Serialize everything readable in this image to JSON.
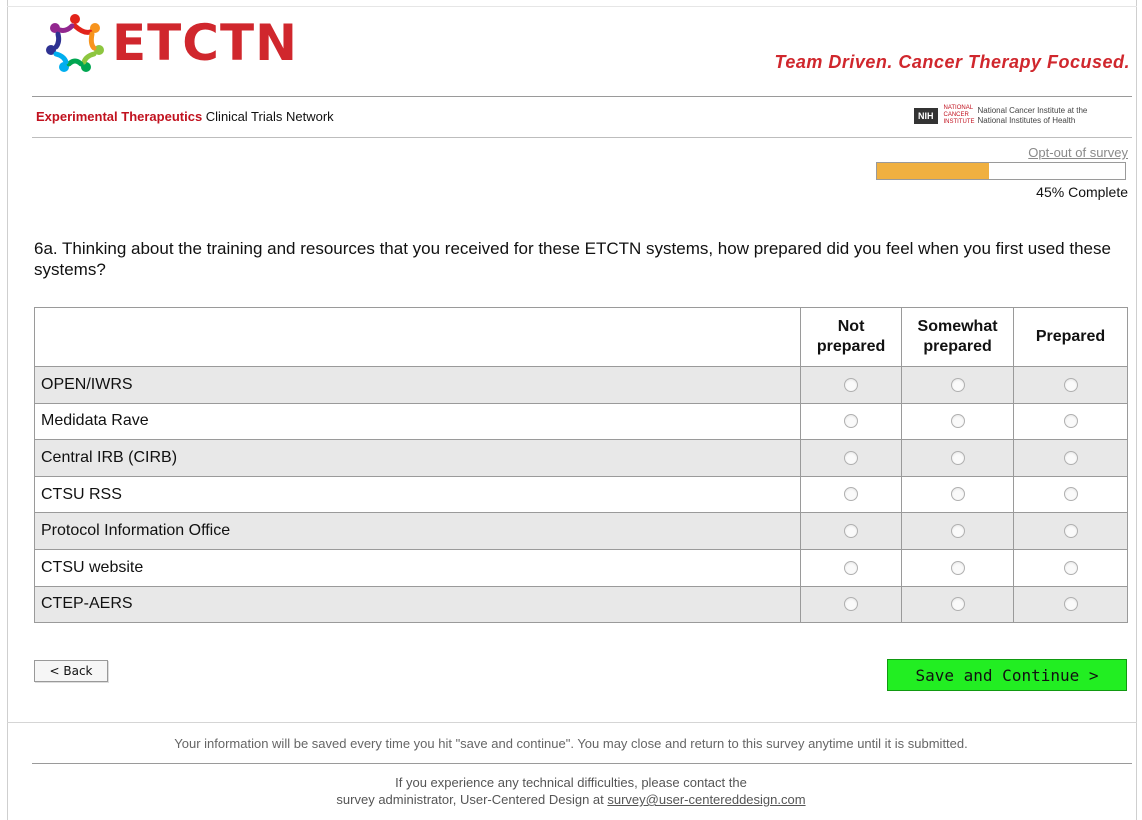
{
  "header": {
    "logo_text": "ETCTN",
    "tagline": "Team Driven. Cancer Therapy Focused.",
    "network_name_bold": "Experimental Therapeutics",
    "network_name_rest": " Clinical Trials Network",
    "nih_label": "NIH",
    "nci_mini": "NATIONAL CANCER INSTITUTE",
    "nci_line1": "National Cancer Institute at the",
    "nci_line2": "National Institutes of Health"
  },
  "survey": {
    "optout_label": "Opt-out of survey",
    "progress_percent": 45,
    "progress_text": "45% Complete",
    "question": "6a. Thinking about the training and resources that you received for these ETCTN systems, how prepared did you feel when you first used these systems?"
  },
  "table": {
    "columns": [
      "Not prepared",
      "Somewhat prepared",
      "Prepared"
    ],
    "rows": [
      {
        "label": "OPEN/IWRS"
      },
      {
        "label": "Medidata Rave"
      },
      {
        "label": "Central IRB (CIRB)"
      },
      {
        "label": "CTSU RSS"
      },
      {
        "label": "Protocol Information Office"
      },
      {
        "label": "CTSU website"
      },
      {
        "label": "CTEP-AERS"
      }
    ]
  },
  "buttons": {
    "back_label": "< Back",
    "save_label": "Save and Continue >"
  },
  "footer": {
    "note": "Your information will be saved every time you hit \"save and continue\". You may close and return to this survey anytime until it is submitted.",
    "contact_line1": "If you experience any technical difficulties, please contact the",
    "contact_line2_prefix": "survey administrator, User-Centered Design at ",
    "contact_email": "survey@user-centereddesign.com"
  },
  "colors": {
    "brand_red": "#d0272d",
    "progress_fill": "#f0b040",
    "save_green": "#22ee22"
  }
}
